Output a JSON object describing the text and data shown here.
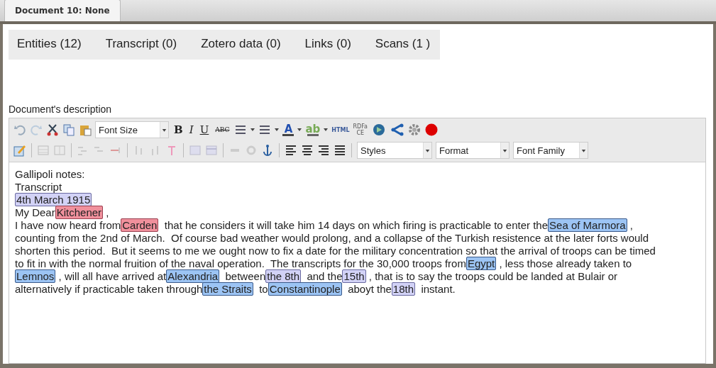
{
  "document_tab": {
    "label": "Document 10: None",
    "selected": true
  },
  "tabs": [
    {
      "label": "Entities (12)",
      "selected": false
    },
    {
      "label": "Transcript (0)",
      "selected": false
    },
    {
      "label": "Zotero data (0)",
      "selected": false
    },
    {
      "label": "Links (0)",
      "selected": false
    },
    {
      "label": "Scans (1 )",
      "selected": false
    }
  ],
  "description_label": "Document's description",
  "toolbar": {
    "font_size": "Font Size",
    "bold": "B",
    "italic": "I",
    "underline": "U",
    "strike": "ABC",
    "font_color": "A",
    "highlight": "ab",
    "html": "HTML",
    "rdfa": "RDFa",
    "ce": "CE",
    "styles": "Styles",
    "format": "Format",
    "font_family": "Font Family"
  },
  "content": [
    [
      {
        "text": "Gallipoli notes:"
      }
    ],
    [
      {
        "text": "Transcript"
      }
    ],
    [
      {
        "text": "4th March 1915",
        "kind": "date"
      }
    ],
    [
      {
        "text": "My Dear"
      },
      {
        "text": "Kitchener",
        "kind": "person"
      },
      {
        "text": " ,"
      }
    ],
    [
      {
        "text": "I have now heard from"
      },
      {
        "text": "Carden",
        "kind": "person"
      },
      {
        "text": "  that he considers it will take him 14 days on which firing is practicable to enter the"
      },
      {
        "text": "Sea of Marmora",
        "kind": "place"
      },
      {
        "text": " ,"
      }
    ],
    [
      {
        "text": "counting from the 2nd of March.  Of course bad weather would prolong, and a collapse of the Turkish resistence at the later forts would"
      }
    ],
    [
      {
        "text": "shorten this period.  But it seems to me we ought now to fix a date for the military concentration so that the arrival of troops can be timed"
      }
    ],
    [
      {
        "text": "to fit in with the normal fruition of the naval operation.  The transcripts for the 30,000 troops from"
      },
      {
        "text": "Egypt",
        "kind": "place"
      },
      {
        "text": " , less those already taken to"
      }
    ],
    [
      {
        "text": "Lemnos",
        "kind": "place"
      },
      {
        "text": " , will all have arrived at"
      },
      {
        "text": "Alexandria",
        "kind": "place"
      },
      {
        "text": "  between"
      },
      {
        "text": "the 8th",
        "kind": "date"
      },
      {
        "text": "  and the"
      },
      {
        "text": "15th",
        "kind": "date"
      },
      {
        "text": " , that is to say the troops could be landed at Bulair or"
      }
    ],
    [
      {
        "text": "alternatively if practicable taken through"
      },
      {
        "text": "the Straits",
        "kind": "place"
      },
      {
        "text": "  to"
      },
      {
        "text": "Constantinople",
        "kind": "place"
      },
      {
        "text": "  aboyt the"
      },
      {
        "text": "18th",
        "kind": "date"
      },
      {
        "text": "  instant."
      }
    ]
  ]
}
